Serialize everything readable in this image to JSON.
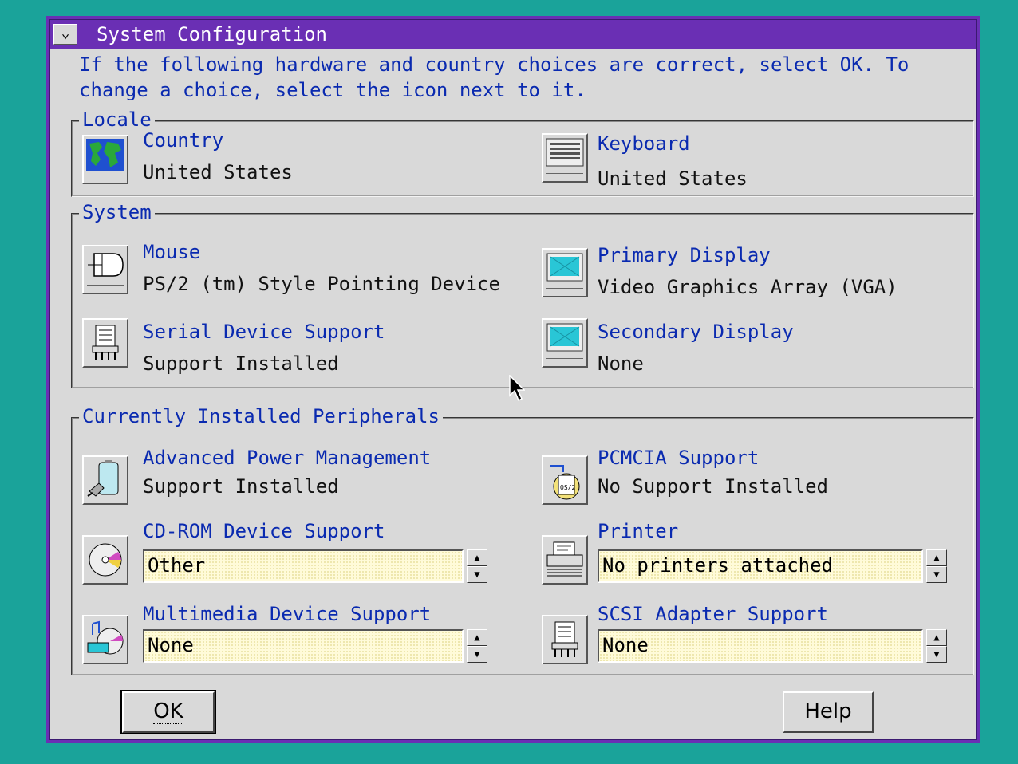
{
  "window": {
    "title": "System Configuration",
    "sysmenu_glyph": "⌄"
  },
  "intro": "If the following hardware and country choices are correct, select OK. To change a choice, select the icon next to it.",
  "groups": {
    "locale": {
      "title": "Locale",
      "country": {
        "label": "Country",
        "value": "United States",
        "icon": "globe-icon"
      },
      "keyboard": {
        "label": "Keyboard",
        "value": "United States",
        "icon": "keyboard-icon"
      }
    },
    "system": {
      "title": "System",
      "mouse": {
        "label": "Mouse",
        "value": "PS/2 (tm) Style Pointing Device",
        "icon": "mouse-icon"
      },
      "primary_display": {
        "label": "Primary Display",
        "value": "Video Graphics Array (VGA)",
        "icon": "monitor-icon"
      },
      "serial": {
        "label": "Serial Device Support",
        "value": "Support Installed",
        "icon": "serial-connector-icon"
      },
      "secondary_display": {
        "label": "Secondary Display",
        "value": "None",
        "icon": "monitor-icon"
      }
    },
    "peripherals": {
      "title": "Currently Installed Peripherals",
      "apm": {
        "label": "Advanced Power Management",
        "value": "Support Installed",
        "icon": "battery-plug-icon"
      },
      "pcmcia": {
        "label": "PCMCIA Support",
        "value": "No Support Installed",
        "icon": "pcmcia-card-icon"
      },
      "cdrom": {
        "label": "CD-ROM Device Support",
        "selected": "Other",
        "icon": "cd-icon"
      },
      "printer": {
        "label": "Printer",
        "selected": "No printers attached",
        "icon": "printer-icon"
      },
      "multimedia": {
        "label": "Multimedia Device Support",
        "selected": "None",
        "icon": "multimedia-icon"
      },
      "scsi": {
        "label": "SCSI Adapter Support",
        "selected": "None",
        "icon": "scsi-connector-icon"
      }
    }
  },
  "buttons": {
    "ok": "OK",
    "help": "Help"
  },
  "spin": {
    "up": "▲",
    "down": "▼"
  },
  "colors": {
    "titlebar": "#6a2fb4",
    "desktop": "#1aa39a",
    "label_blue": "#0a2ab0",
    "field_yellow": "#fffbd9"
  }
}
